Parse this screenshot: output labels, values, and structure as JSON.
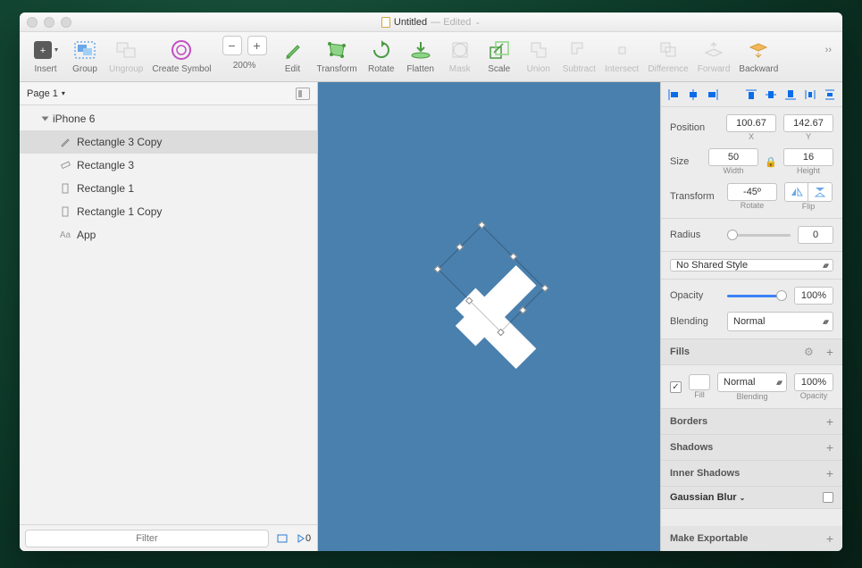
{
  "window": {
    "title": "Untitled",
    "title_suffix": "— Edited"
  },
  "toolbar": {
    "insert": "Insert",
    "group": "Group",
    "ungroup": "Ungroup",
    "create_symbol": "Create Symbol",
    "zoom_value": "200%",
    "edit": "Edit",
    "transform": "Transform",
    "rotate": "Rotate",
    "flatten": "Flatten",
    "mask": "Mask",
    "scale": "Scale",
    "union": "Union",
    "subtract": "Subtract",
    "intersect": "Intersect",
    "difference": "Difference",
    "forward": "Forward",
    "backward": "Backward"
  },
  "pages": {
    "label": "Page 1"
  },
  "layers": {
    "artboard": "iPhone 6",
    "items": [
      {
        "label": "Rectangle 3 Copy",
        "icon": "pencil",
        "selected": true
      },
      {
        "label": "Rectangle 3",
        "icon": "rect-outline"
      },
      {
        "label": "Rectangle 1",
        "icon": "rect-portrait"
      },
      {
        "label": "Rectangle 1 Copy",
        "icon": "rect-portrait"
      },
      {
        "label": "App",
        "icon": "text"
      }
    ]
  },
  "filter": {
    "placeholder": "Filter",
    "slice_count": "0"
  },
  "inspector": {
    "position_label": "Position",
    "x": "100.67",
    "x_sub": "X",
    "y": "142.67",
    "y_sub": "Y",
    "size_label": "Size",
    "w": "50",
    "w_sub": "Width",
    "h": "16",
    "h_sub": "Height",
    "transform_label": "Transform",
    "rotate": "-45º",
    "rotate_sub": "Rotate",
    "flip_sub": "Flip",
    "radius_label": "Radius",
    "radius": "0",
    "shared_style": "No Shared Style",
    "opacity_label": "Opacity",
    "opacity": "100%",
    "blending_label": "Blending",
    "blending": "Normal",
    "fills_title": "Fills",
    "fill_sub": "Fill",
    "fill_blend": "Normal",
    "fill_blend_sub": "Blending",
    "fill_opacity": "100%",
    "fill_opacity_sub": "Opacity",
    "borders_title": "Borders",
    "shadows_title": "Shadows",
    "inner_shadows_title": "Inner Shadows",
    "blur_title": "Gaussian Blur",
    "export_title": "Make Exportable"
  }
}
